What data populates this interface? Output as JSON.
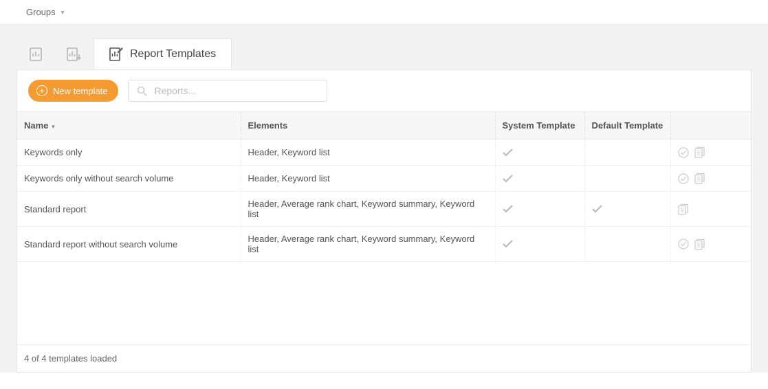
{
  "topbar": {
    "groups_label": "Groups"
  },
  "tabs": {
    "active_label": "Report Templates"
  },
  "toolbar": {
    "new_template_label": "New template",
    "search_placeholder": "Reports..."
  },
  "table": {
    "headers": {
      "name": "Name",
      "elements": "Elements",
      "system": "System Template",
      "default": "Default Template"
    },
    "rows": [
      {
        "name": "Keywords only",
        "elements": "Header, Keyword list",
        "system": true,
        "default": false,
        "show_approve": true
      },
      {
        "name": "Keywords only without search volume",
        "elements": "Header, Keyword list",
        "system": true,
        "default": false,
        "show_approve": true
      },
      {
        "name": "Standard report",
        "elements": "Header, Average rank chart, Keyword summary, Keyword list",
        "system": true,
        "default": true,
        "show_approve": false
      },
      {
        "name": "Standard report without search volume",
        "elements": "Header, Average rank chart, Keyword summary, Keyword list",
        "system": true,
        "default": false,
        "show_approve": true
      }
    ],
    "footer": "4 of 4 templates loaded"
  }
}
